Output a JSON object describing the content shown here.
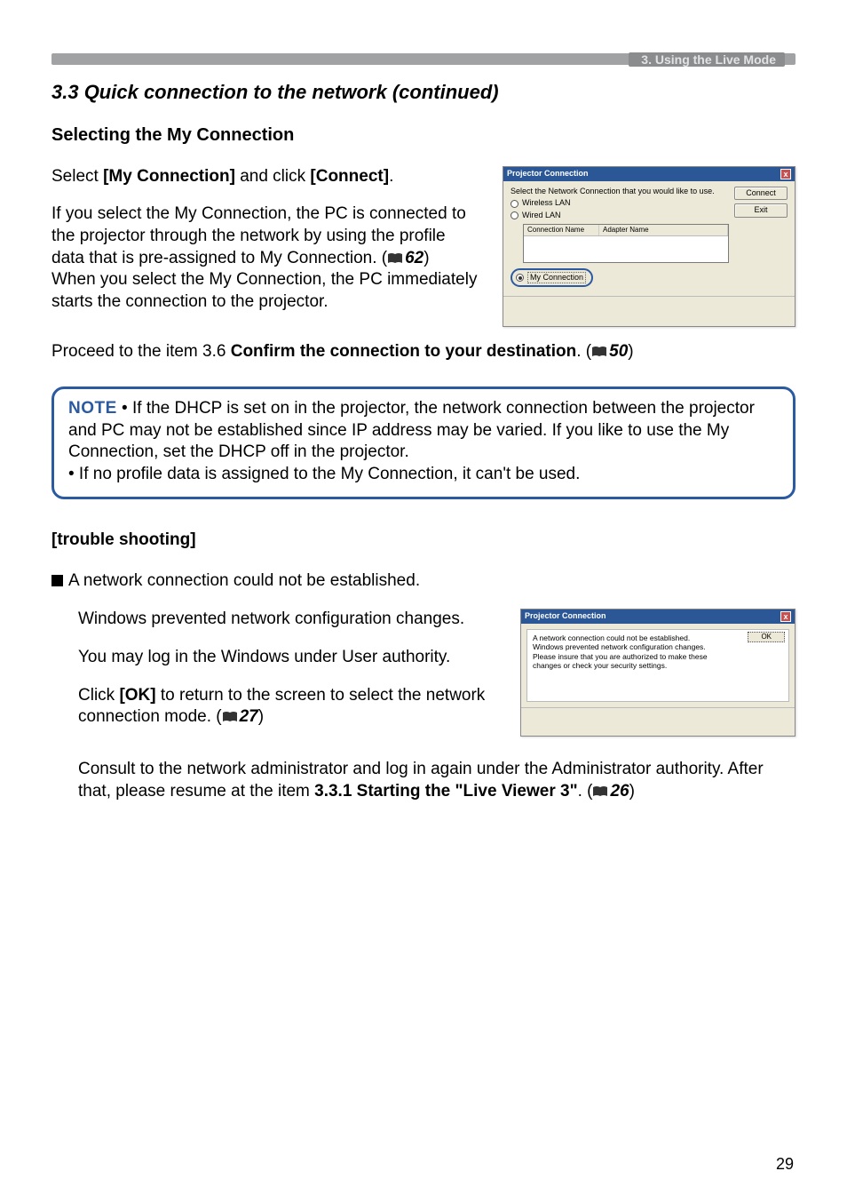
{
  "header": {
    "breadcrumb": "3. Using the Live Mode"
  },
  "section_title": "3.3 Quick connection to the network (continued)",
  "subheading": "Selecting the My Connection",
  "intro_line_pre": "Select ",
  "intro_bold1": "[My Connection]",
  "intro_mid": " and click ",
  "intro_bold2": "[Connect]",
  "intro_post": ".",
  "para1a": "If you select the My Connection, the PC is connected to the projector through the network by using the profile data that is pre-assigned to My Connection. (",
  "ref62": "62",
  "para1b": ")",
  "para1c": "When you select the My Connection, the PC immediately starts the connection to the projector.",
  "proceed_pre": "Proceed to the item 3.6 ",
  "proceed_bold": "Confirm the connection to your destination",
  "proceed_post": ". (",
  "ref50": "50",
  "proceed_end": ")",
  "note": {
    "label": "NOTE",
    "l1": " • If the DHCP is set on in the projector, the network connection between the projector and PC may not be established since IP address may be varied. If you like to use the My Connection, set the DHCP off in the projector.",
    "l2": "• If no profile data is assigned to the My Connection, it can't be used."
  },
  "trouble": {
    "heading": "[trouble shooting]",
    "bullet": "A network connection could not be established.",
    "p1": "Windows prevented network configuration changes.",
    "p2": "You may log in the Windows under User authority.",
    "p3a": "Click ",
    "p3b": "[OK]",
    "p3c": " to return to the screen to select the network connection mode. (",
    "ref27": "27",
    "p3d": ")",
    "p4a": "Consult to the network administrator and log in again under the Administrator authority. After that, please resume at the item ",
    "p4b": "3.3.1 Starting the \"Live Viewer 3\"",
    "p4c": ". (",
    "ref26": "26",
    "p4d": ")"
  },
  "dialog1": {
    "title": "Projector Connection",
    "instruction": "Select the Network Connection that you would like to use.",
    "wireless": "Wireless LAN",
    "wired": "Wired LAN",
    "col_conn": "Connection Name",
    "col_adapter": "Adapter Name",
    "my_connection": "My Connection",
    "btn_connect": "Connect",
    "btn_exit": "Exit"
  },
  "dialog2": {
    "title": "Projector Connection",
    "msg1": "A network connection could not be established.",
    "msg2": "Windows prevented network configuration changes.",
    "msg3": "Please insure that you are authorized to make these",
    "msg4": "changes or check your security settings.",
    "ok": "OK"
  },
  "page_number": "29"
}
